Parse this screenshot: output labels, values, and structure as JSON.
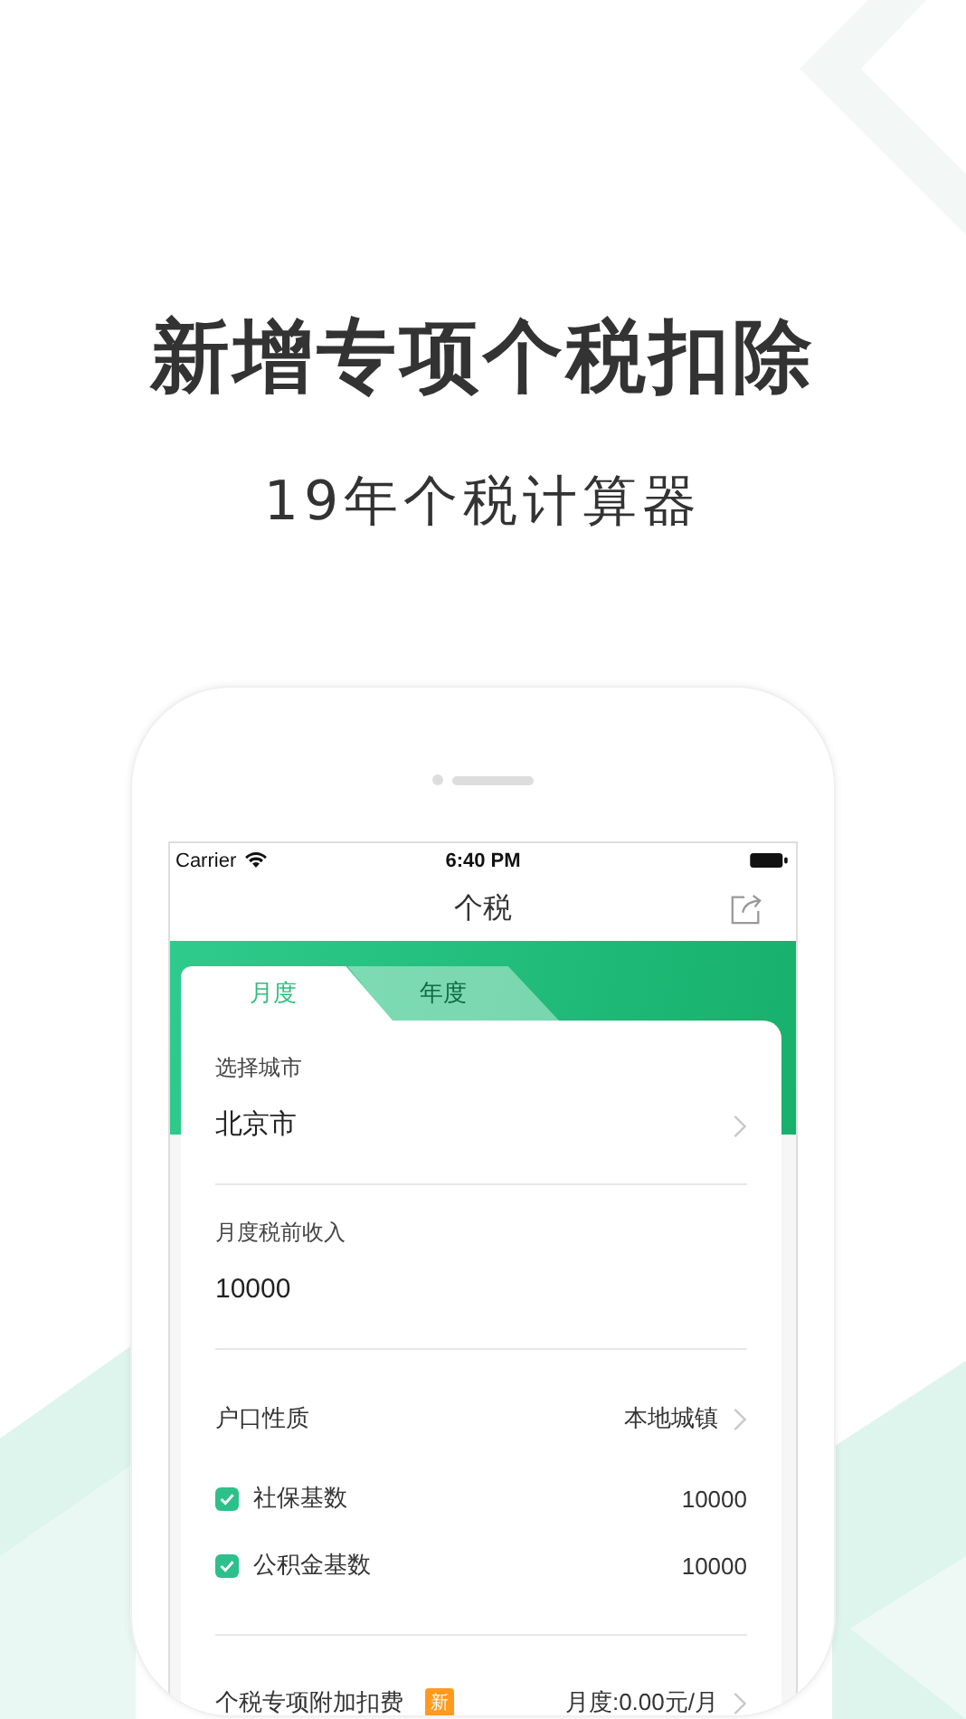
{
  "headline": "新增专项个税扣除",
  "subtitle": "19年个税计算器",
  "status_bar": {
    "carrier": "Carrier",
    "time": "6:40 PM"
  },
  "nav": {
    "title": "个税"
  },
  "tabs": [
    {
      "label": "月度",
      "selected": true
    },
    {
      "label": "年度",
      "selected": false
    }
  ],
  "sections": [
    {
      "rows": [
        {
          "kind": "field",
          "label": "选择城市",
          "value": "北京市",
          "chevron": true
        }
      ]
    },
    {
      "rows": [
        {
          "kind": "field",
          "label": "月度税前收入",
          "value": "10000",
          "chevron": false
        }
      ]
    },
    {
      "rows": [
        {
          "kind": "select",
          "label": "户口性质",
          "value": "本地城镇"
        },
        {
          "kind": "check",
          "label": "社保基数",
          "value": "10000",
          "checked": true
        },
        {
          "kind": "check",
          "label": "公积金基数",
          "value": "10000",
          "checked": true
        }
      ]
    },
    {
      "rows": [
        {
          "kind": "select",
          "label": "个税专项附加扣费",
          "badge": "新",
          "value": "月度:0.00元/月"
        }
      ]
    }
  ]
}
